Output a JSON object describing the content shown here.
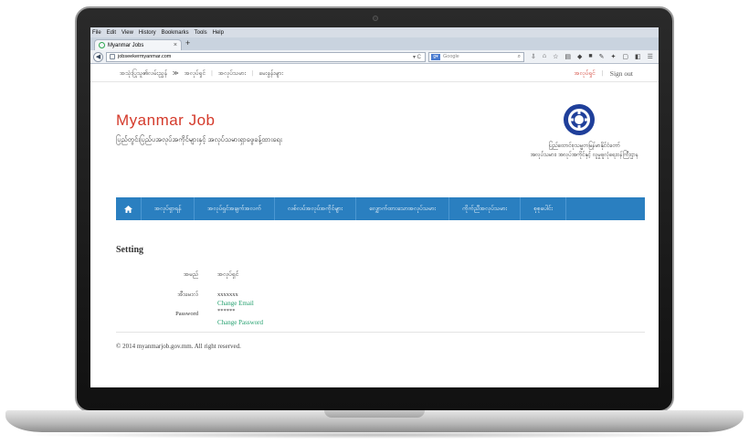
{
  "browser": {
    "menus": [
      "File",
      "Edit",
      "View",
      "History",
      "Bookmarks",
      "Tools",
      "Help"
    ],
    "tab_title": "Myanmar Jobs",
    "url": "jobseekermyanmar.com",
    "search_placeholder": "Google"
  },
  "topbar": {
    "crumbs": [
      "အသုံးပြုသူ၏လမ်းညွှန်",
      "≫",
      "အလုပ်ရှင်",
      "အလုပ်သမား",
      "မေးခွန်းများ"
    ],
    "user_link": "အလုပ်ရှင်",
    "signout": "Sign out"
  },
  "header": {
    "brand": "Myanmar Job",
    "tagline": "ပြည်တွင်းပြည်ပအလုပ်အကိုင်များနှင့် အလုပ်သမားရှာဖွေခန့်ထားရေး",
    "ministry_line1": "ပြည်ထောင်စုသမ္မတမြန်မာနိုင်ငံတော်",
    "ministry_line2": "အလုပ်သမား၊ အလုပ်အကိုင်နှင့် လူမှုဖူလုံရေးဝန်ကြီးဌာန"
  },
  "nav": {
    "items": [
      "အလုပ်ရှာရန်",
      "အလုပ်ရှင်အချက်အလက်",
      "လစ်လပ်အလုပ်အကိုင်များ",
      "လျှောက်ထားသောအလုပ်သမား",
      "ကိုက်ညီအလုပ်သမား",
      "စုစုပေါင်း"
    ]
  },
  "settings": {
    "title": "Setting",
    "name_label": "အမည်",
    "name_value": "အလုပ်ရှင်",
    "email_label": "အီးမေးလ်",
    "email_value": "xxxxxxx",
    "change_email": "Change Email",
    "password_label": "Password",
    "password_value": "******",
    "change_password": "Change Password"
  },
  "footer": {
    "text": "© 2014 myanmarjob.gov.mm. All right reserved."
  },
  "colors": {
    "brand_red": "#d43a2b",
    "nav_blue": "#2a7fc0",
    "link_green": "#23a06e"
  }
}
